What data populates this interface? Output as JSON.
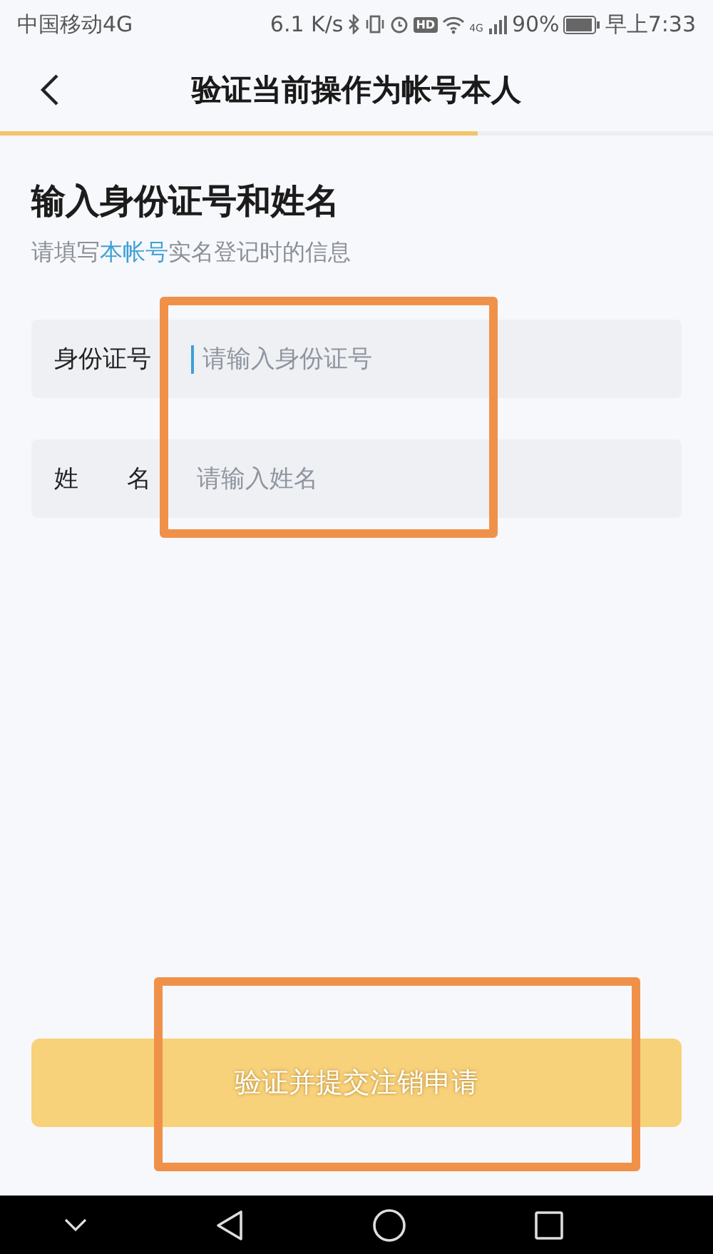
{
  "status_bar": {
    "carrier": "中国移动4G",
    "speed": "6.1 K/s",
    "hd": "HD",
    "net": "4G",
    "battery": "90%",
    "time": "早上7:33"
  },
  "header": {
    "title": "验证当前操作为帐号本人",
    "progress": {
      "level": 0.67
    }
  },
  "heading": "输入身份证号和姓名",
  "subtitle": "请填写**本帐号**实名登记时的信息",
  "fields": [
    {
      "label": "身份证号",
      "placeholder": "请输入身份证号",
      "focused": true
    },
    {
      "label": "姓　　名",
      "placeholder": "请输入姓名",
      "focused": false
    }
  ],
  "submit": {
    "label": "验证并提交注销申请",
    "disabled": true
  },
  "annotations": [
    {
      "kind": "frame",
      "color": "#f0914a"
    },
    {
      "kind": "frame",
      "color": "#f0914a"
    }
  ]
}
